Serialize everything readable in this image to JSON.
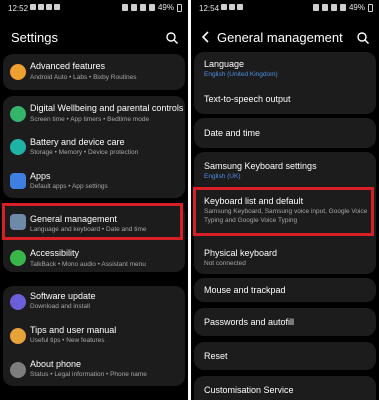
{
  "left": {
    "status": {
      "time": "12:52",
      "battery": "49%"
    },
    "title": "Settings",
    "items": [
      {
        "title": "Advanced features",
        "subtitle": "Android Auto  •  Labs  •  Bixby Routines",
        "color": "#f0a030"
      },
      {
        "title": "Digital Wellbeing and parental controls",
        "subtitle": "Screen time  •  App timers  •  Bedtime mode",
        "color": "#34b36b"
      },
      {
        "title": "Battery and device care",
        "subtitle": "Storage  •  Memory  •  Device protection",
        "color": "#1fb3a6"
      },
      {
        "title": "Apps",
        "subtitle": "Default apps  •  App settings",
        "color": "#3f7fe0"
      },
      {
        "title": "General management",
        "subtitle": "Language and keyboard  •  Date and time",
        "color": "#6f8aa8"
      },
      {
        "title": "Accessibility",
        "subtitle": "TalkBack  •  Mono audio  •  Assistant menu",
        "color": "#39b54a"
      },
      {
        "title": "Software update",
        "subtitle": "Download and install",
        "color": "#6a5fd8"
      },
      {
        "title": "Tips and user manual",
        "subtitle": "Useful tips  •  New features",
        "color": "#e8a23a"
      },
      {
        "title": "About phone",
        "subtitle": "Status  •  Legal information  •  Phone name",
        "color": "#7d7d7d"
      }
    ]
  },
  "right": {
    "status": {
      "time": "12:54",
      "battery": "49%"
    },
    "title": "General management",
    "items": [
      {
        "title": "Language",
        "subtitle": "English (United Kingdom)"
      },
      {
        "title": "Text-to-speech output"
      },
      {
        "title": "Date and time"
      },
      {
        "title": "Samsung Keyboard settings",
        "subtitle": "English (UK)"
      },
      {
        "title": "Keyboard list and default",
        "subtitle": "Samsung Keyboard, Samsung voice input, Google Voice Typing and Google Voice Typing"
      },
      {
        "title": "Physical keyboard",
        "subtitle": "Not connected"
      },
      {
        "title": "Mouse and trackpad"
      },
      {
        "title": "Passwords and autofill"
      },
      {
        "title": "Reset"
      },
      {
        "title": "Customisation Service"
      }
    ]
  },
  "colors": {
    "highlight": "#d81f26",
    "accent_blue": "#4f8fe8",
    "card": "#1c1c1c"
  }
}
